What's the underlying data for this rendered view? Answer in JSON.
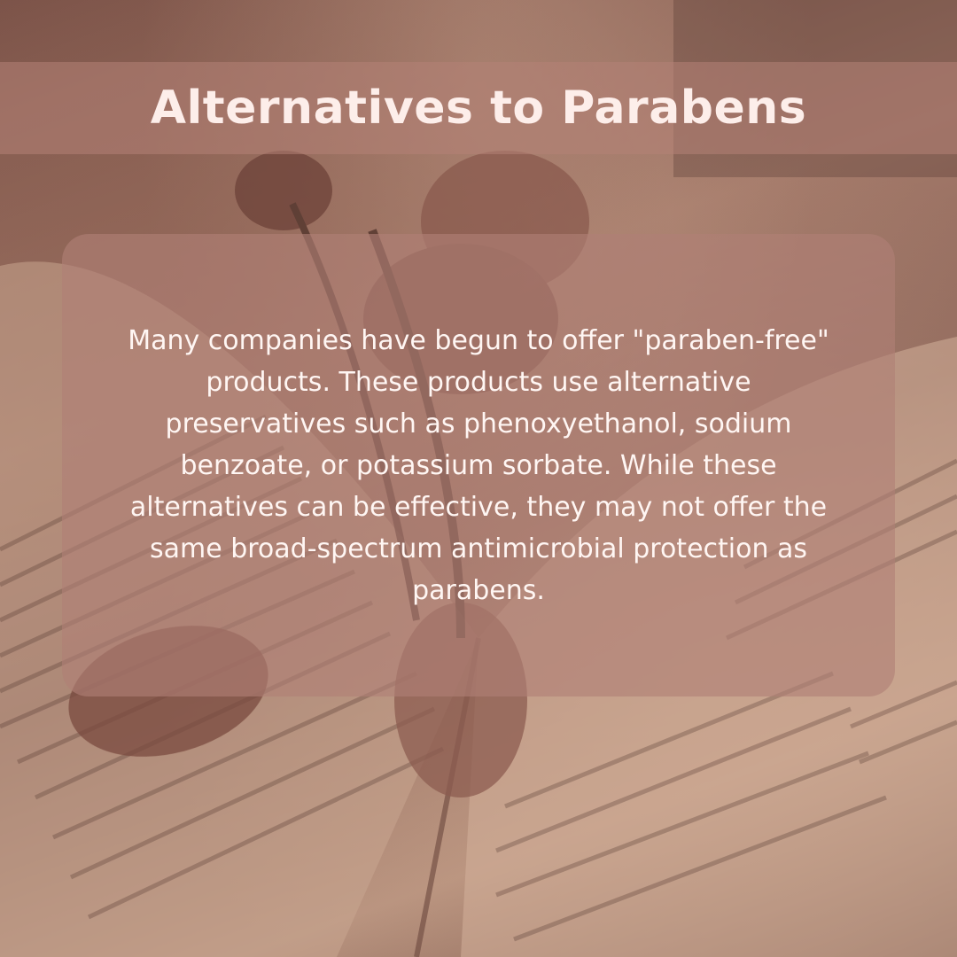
{
  "title": "Alternatives to Parabens",
  "body": "Many companies have begun to offer \"paraben-free\" products. These products use alternative preservatives such as phenoxyethanol, sodium benzoate, or potassium sorbate. While these alternatives can be effective, they may not offer the same broad-spectrum antimicrobial protection as parabens.",
  "background": {
    "image": "dried-roses-on-open-book-photo",
    "overlay_color": "#b08076"
  },
  "colors": {
    "title_text": "#fdeeea",
    "body_text": "#fff6f3",
    "title_band": "#b4827600"
  }
}
